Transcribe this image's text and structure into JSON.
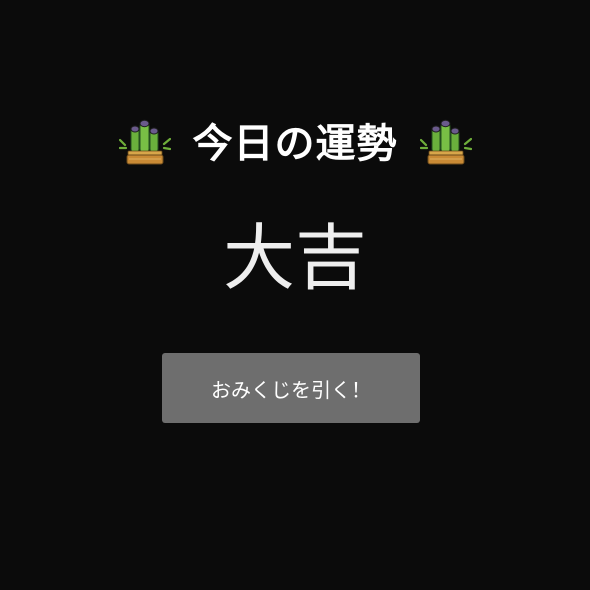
{
  "header": {
    "title": "今日の運勢",
    "left_icon": "kadomatsu-icon",
    "right_icon": "kadomatsu-icon"
  },
  "result": {
    "fortune": "大吉"
  },
  "actions": {
    "draw_label": "おみくじを引く！"
  },
  "colors": {
    "background": "#0b0b0b",
    "button": "#6e6e6e",
    "text": "#ffffff"
  }
}
